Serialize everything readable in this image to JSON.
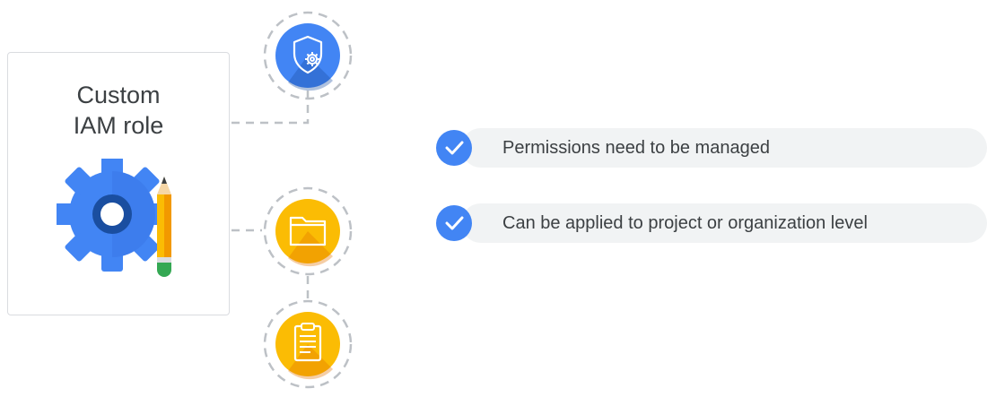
{
  "card": {
    "title_line1": "Custom",
    "title_line2": "IAM role",
    "icon": "gear-pencil-icon"
  },
  "nodes": [
    {
      "icon": "shield-gear-icon",
      "color": "#4285f4"
    },
    {
      "icon": "folder-icon",
      "color": "#fbbc04"
    },
    {
      "icon": "clipboard-icon",
      "color": "#fbbc04"
    }
  ],
  "checklist": [
    {
      "text": "Permissions need to be managed"
    },
    {
      "text": "Can be applied to project or organization level"
    }
  ],
  "colors": {
    "blue": "#4285f4",
    "dark_blue": "#1a4ea0",
    "yellow": "#fbbc04",
    "green": "#34a853",
    "pill_bg": "#f1f3f4",
    "dash": "#bdc1c6"
  }
}
